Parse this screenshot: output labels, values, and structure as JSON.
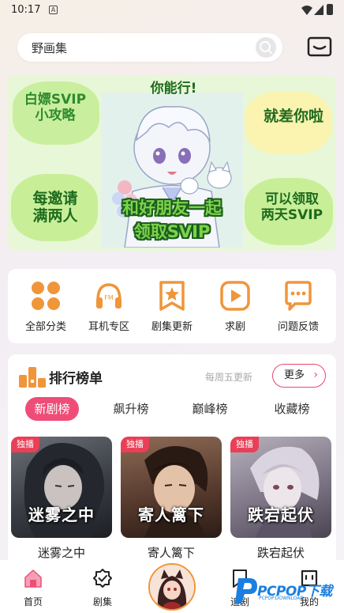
{
  "status_bar": {
    "time": "10:17",
    "notification_glyph": "A"
  },
  "search": {
    "placeholder": "野画集"
  },
  "banner": {
    "top_left": "白嫖SVIP\n小攻略",
    "top_center": "你能行!",
    "top_right": "就差你啦",
    "bottom_left": "每邀请\n满两人",
    "center_line1": "和好朋友一起",
    "center_line2": "领取SVIP",
    "bottom_right": "可以领取\n两天SVIP"
  },
  "quick_menu": [
    {
      "label": "全部分类",
      "icon": "grid-icon"
    },
    {
      "label": "耳机专区",
      "icon": "headphones-icon"
    },
    {
      "label": "剧集更新",
      "icon": "star-bookmark-icon"
    },
    {
      "label": "求剧",
      "icon": "play-icon"
    },
    {
      "label": "问题反馈",
      "icon": "chat-icon"
    }
  ],
  "ranking": {
    "title": "排行榜单",
    "update_note": "每周五更新",
    "more_label": "更多",
    "tabs": [
      "新剧榜",
      "飙升榜",
      "巅峰榜",
      "收藏榜"
    ],
    "active_tab": 0,
    "items": [
      {
        "badge": "独播",
        "cover_text": "迷雾之中",
        "name": "迷雾之中"
      },
      {
        "badge": "独播",
        "cover_text": "寄人篱下",
        "name": "寄人篱下"
      },
      {
        "badge": "独播",
        "cover_text": "跌宕起伏",
        "name": "跌宕起伏"
      }
    ]
  },
  "bottom_nav": [
    {
      "label": "首页",
      "icon": "home-icon",
      "active": true
    },
    {
      "label": "剧集",
      "icon": "badge-check-icon"
    },
    {
      "label": "追剧",
      "icon": "bookmark-icon"
    },
    {
      "label": "我的",
      "icon": "profile-icon"
    }
  ],
  "watermark": {
    "text": "PCPOP下载",
    "sub": "PCPOP.DOWNLOAD"
  },
  "colors": {
    "accent_pink": "#ef4d78",
    "menu_orange": "#f0953a",
    "banner_green": "#e8f7d8",
    "badge_red": "#ea3f56"
  }
}
